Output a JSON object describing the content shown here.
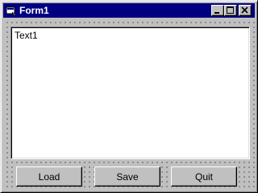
{
  "window": {
    "title": "Form1",
    "titlebar_color": "#000080",
    "face_color": "#c0c0c0",
    "controls": [
      "minimize-icon",
      "maximize-icon",
      "close-icon"
    ]
  },
  "textbox": {
    "value": "Text1"
  },
  "buttons": {
    "load": "Load",
    "save": "Save",
    "quit": "Quit"
  }
}
